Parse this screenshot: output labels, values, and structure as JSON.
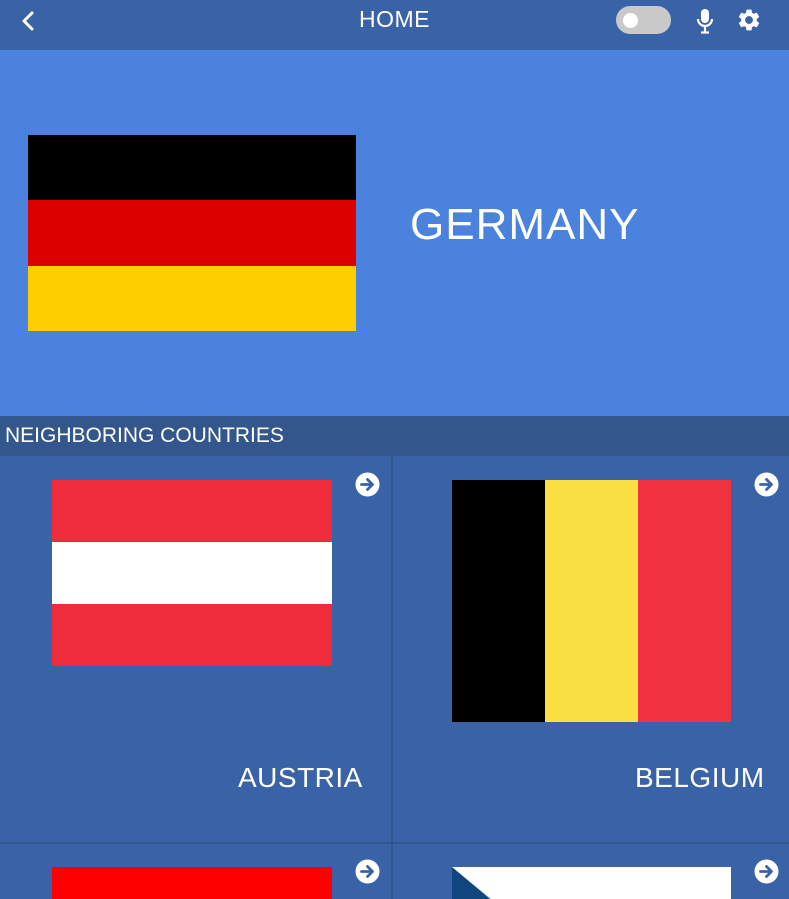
{
  "header": {
    "title": "HOME",
    "back_icon": "chevron-left-icon",
    "toggle_state": "off",
    "mic_icon": "microphone-icon",
    "settings_icon": "gear-icon"
  },
  "hero": {
    "country": "GERMANY",
    "flag_colors": [
      "#000000",
      "#dd0000",
      "#ffce00"
    ]
  },
  "section": {
    "title": "NEIGHBORING COUNTRIES"
  },
  "neighbors": [
    {
      "name": "AUSTRIA",
      "flag_colors": [
        "#ef2b3c",
        "#ffffff",
        "#ef2b3c"
      ],
      "arrow_icon": "arrow-right-circle-icon"
    },
    {
      "name": "BELGIUM",
      "flag_colors": [
        "#000000",
        "#fae042",
        "#ef3340"
      ],
      "arrow_icon": "arrow-right-circle-icon"
    },
    {
      "name": "",
      "flag_colors": [
        "#ff0000"
      ],
      "arrow_icon": "arrow-right-circle-icon"
    },
    {
      "name": "",
      "flag_colors": [
        "#ffffff",
        "#11457e"
      ],
      "arrow_icon": "arrow-right-circle-icon"
    }
  ],
  "colors": {
    "topbar": "#3a63a7",
    "hero_bg": "#4a82dd",
    "section_bg": "#33568c",
    "card_bg": "#3a63a7"
  }
}
